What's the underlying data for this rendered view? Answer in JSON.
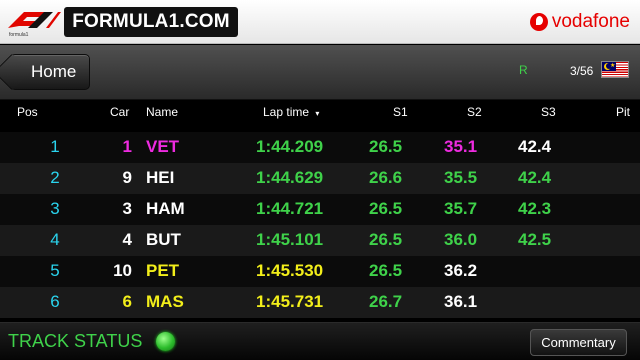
{
  "brand": {
    "f1_site": "FORMULA1.COM",
    "sponsor": "vodafone"
  },
  "nav": {
    "home_label": "Home",
    "session_flag": "R",
    "lap_count": "3/56",
    "flag_icon": "malaysia-flag-icon"
  },
  "colors": {
    "personal_best": "#3fd24a",
    "overall_best": "#ee2be0",
    "in_pit": "#f2ee1a",
    "position": "#2ad4ee"
  },
  "table": {
    "columns": {
      "pos": "Pos",
      "car": "Car",
      "name": "Name",
      "lap_time": "Lap time",
      "sort_icon": "sort-down-icon",
      "s1": "S1",
      "s2": "S2",
      "s3": "S3",
      "pit": "Pit"
    },
    "rows": [
      {
        "pos": "1",
        "car": "1",
        "name": "VET",
        "lap": "1:44.209",
        "s1": "26.5",
        "s2": "35.1",
        "s3": "42.4",
        "pit": "",
        "car_color": "mag",
        "name_color": "mag",
        "s1_color": "grn",
        "s2_color": "mag",
        "s3_color": "wht"
      },
      {
        "pos": "2",
        "car": "9",
        "name": "HEI",
        "lap": "1:44.629",
        "s1": "26.6",
        "s2": "35.5",
        "s3": "42.4",
        "pit": "",
        "car_color": "wht",
        "name_color": "wht",
        "s1_color": "grn",
        "s2_color": "grn",
        "s3_color": "grn"
      },
      {
        "pos": "3",
        "car": "3",
        "name": "HAM",
        "lap": "1:44.721",
        "s1": "26.5",
        "s2": "35.7",
        "s3": "42.3",
        "pit": "",
        "car_color": "wht",
        "name_color": "wht",
        "s1_color": "grn",
        "s2_color": "grn",
        "s3_color": "grn"
      },
      {
        "pos": "4",
        "car": "4",
        "name": "BUT",
        "lap": "1:45.101",
        "s1": "26.5",
        "s2": "36.0",
        "s3": "42.5",
        "pit": "",
        "car_color": "wht",
        "name_color": "wht",
        "s1_color": "grn",
        "s2_color": "grn",
        "s3_color": "grn"
      },
      {
        "pos": "5",
        "car": "10",
        "name": "PET",
        "lap": "1:45.530",
        "s1": "26.5",
        "s2": "36.2",
        "s3": "",
        "pit": "",
        "car_color": "wht",
        "name_color": "yel",
        "s1_color": "grn",
        "s2_color": "wht",
        "s3_color": "wht",
        "lap_color": "yel"
      },
      {
        "pos": "6",
        "car": "6",
        "name": "MAS",
        "lap": "1:45.731",
        "s1": "26.7",
        "s2": "36.1",
        "s3": "",
        "pit": "",
        "car_color": "yel",
        "name_color": "yel",
        "s1_color": "grn",
        "s2_color": "wht",
        "s3_color": "wht",
        "lap_color": "yel"
      }
    ]
  },
  "footer": {
    "track_status_label": "TRACK STATUS",
    "track_status_light": "green",
    "commentary_label": "Commentary"
  }
}
